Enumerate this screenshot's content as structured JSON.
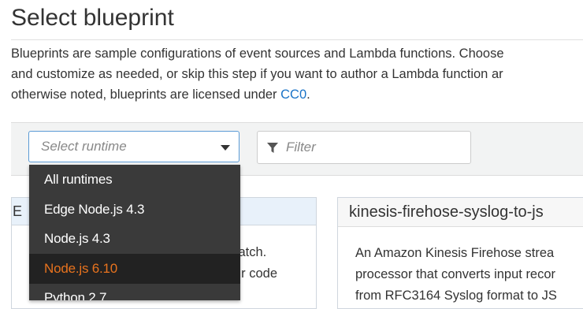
{
  "page": {
    "title": "Select blueprint",
    "description": {
      "line1": "Blueprints are sample configurations of event sources and Lambda functions. Choose",
      "line2": "and customize as needed, or skip this step if you want to author a Lambda function ar",
      "line3_prefix": "otherwise noted, blueprints are licensed under ",
      "line3_link": "CC0",
      "line3_suffix": "."
    }
  },
  "toolbar": {
    "runtime_select": {
      "placeholder": "Select runtime",
      "caret_icon": "chevron-down-icon"
    },
    "filter": {
      "placeholder": "Filter",
      "icon": "filter-funnel-icon"
    }
  },
  "dropdown": {
    "options": [
      {
        "label": "All runtimes",
        "selected": false
      },
      {
        "label": "Edge Node.js 4.3",
        "selected": false
      },
      {
        "label": "Node.js 4.3",
        "selected": false
      },
      {
        "label": "Node.js 6.10",
        "selected": true
      },
      {
        "label": "Python 2.7",
        "selected": false
      }
    ],
    "selected_color": "#e8731e"
  },
  "cards": {
    "left": {
      "title_fragment": "E",
      "body_lines": [
        "ratch.",
        "ur code"
      ]
    },
    "right": {
      "title": "kinesis-firehose-syslog-to-js",
      "body_lines": [
        "An Amazon Kinesis Firehose strea",
        "processor that converts input recor",
        "from RFC3164 Syslog format to JS"
      ]
    }
  },
  "colors": {
    "link": "#1a73c7",
    "toolbar_bg": "#f2f3f3",
    "dropdown_bg": "#3a3a3a",
    "focus_border": "#5b9bd5"
  }
}
